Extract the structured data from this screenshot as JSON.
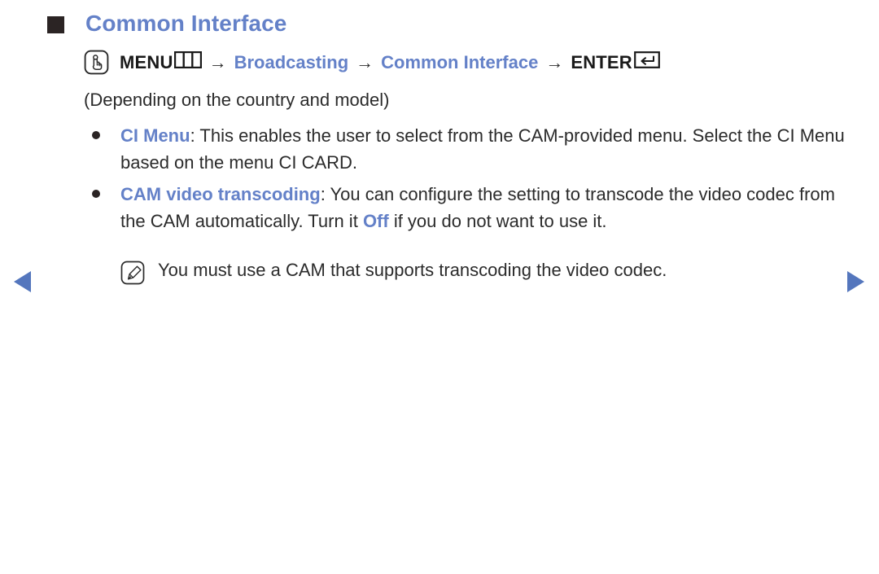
{
  "heading": {
    "title": "Common Interface",
    "marker_color": "#2b2424",
    "color": "#6481c8"
  },
  "breadcrumb": {
    "touch_icon": "hand-touch-icon",
    "menu_label": "MENU",
    "menu_cells_icon": "menu-bars-icon",
    "arrow1": "→",
    "item_broadcasting": "Broadcasting",
    "arrow2": "→",
    "item_common_interface": "Common Interface",
    "arrow3": "→",
    "enter_label": "ENTER",
    "enter_key_icon": "enter-return-key-icon"
  },
  "content": {
    "depends_note": "(Depending on the country and model)",
    "bullets": [
      {
        "keyword": "CI Menu",
        "separator": ": ",
        "text": "This enables the user to select from the CAM-provided menu. Select the CI Menu based on the menu CI CARD."
      },
      {
        "keyword": "CAM video transcoding",
        "separator": ": ",
        "text_before": "You can configure the setting to transcode the video codec from the CAM automatically. Turn it ",
        "inline_keyword": "Off",
        "text_after": " if you do not want to use it."
      }
    ],
    "note": {
      "icon": "note-pencil-icon",
      "text": "You must use a CAM that supports transcoding the video codec."
    }
  },
  "navigation": {
    "prev_icon": "triangle-left-icon",
    "next_icon": "triangle-right-icon",
    "arrow_color": "#5476bd"
  }
}
